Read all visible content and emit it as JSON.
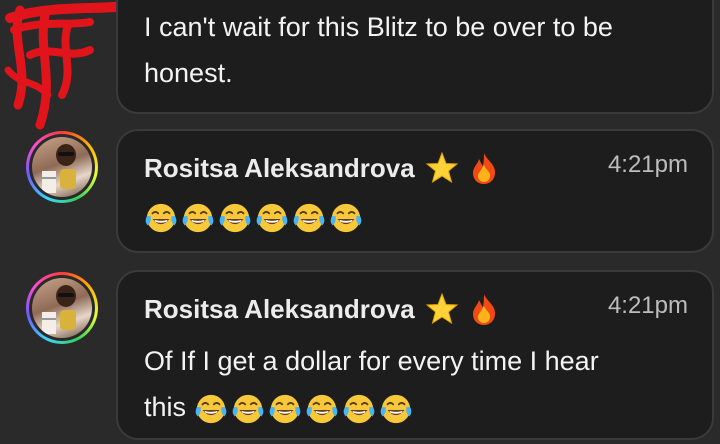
{
  "messages": [
    {
      "text_line1": "I can't wait for this Blitz to be over to be",
      "text_line2": "honest."
    },
    {
      "sender": "Rositsa Aleksandrova",
      "time": "4:21pm",
      "emoji_count": 6,
      "badges": [
        "star-icon",
        "fire-icon"
      ]
    },
    {
      "sender": "Rositsa Aleksandrova",
      "time": "4:21pm",
      "text_line1": "Of If I get a dollar for every time I hear",
      "text_line2": "this",
      "emoji_count": 6,
      "badges": [
        "star-icon",
        "fire-icon"
      ]
    }
  ],
  "colors": {
    "background": "#2a2a2a",
    "bubble": "#1d1d1d",
    "bubble_border": "#3a3a3a",
    "redaction": "#e0141a"
  },
  "icons": {
    "emoji": "face-with-tears-of-joy-icon",
    "star": "star-icon",
    "fire": "fire-icon",
    "redaction": "red-scribble"
  }
}
